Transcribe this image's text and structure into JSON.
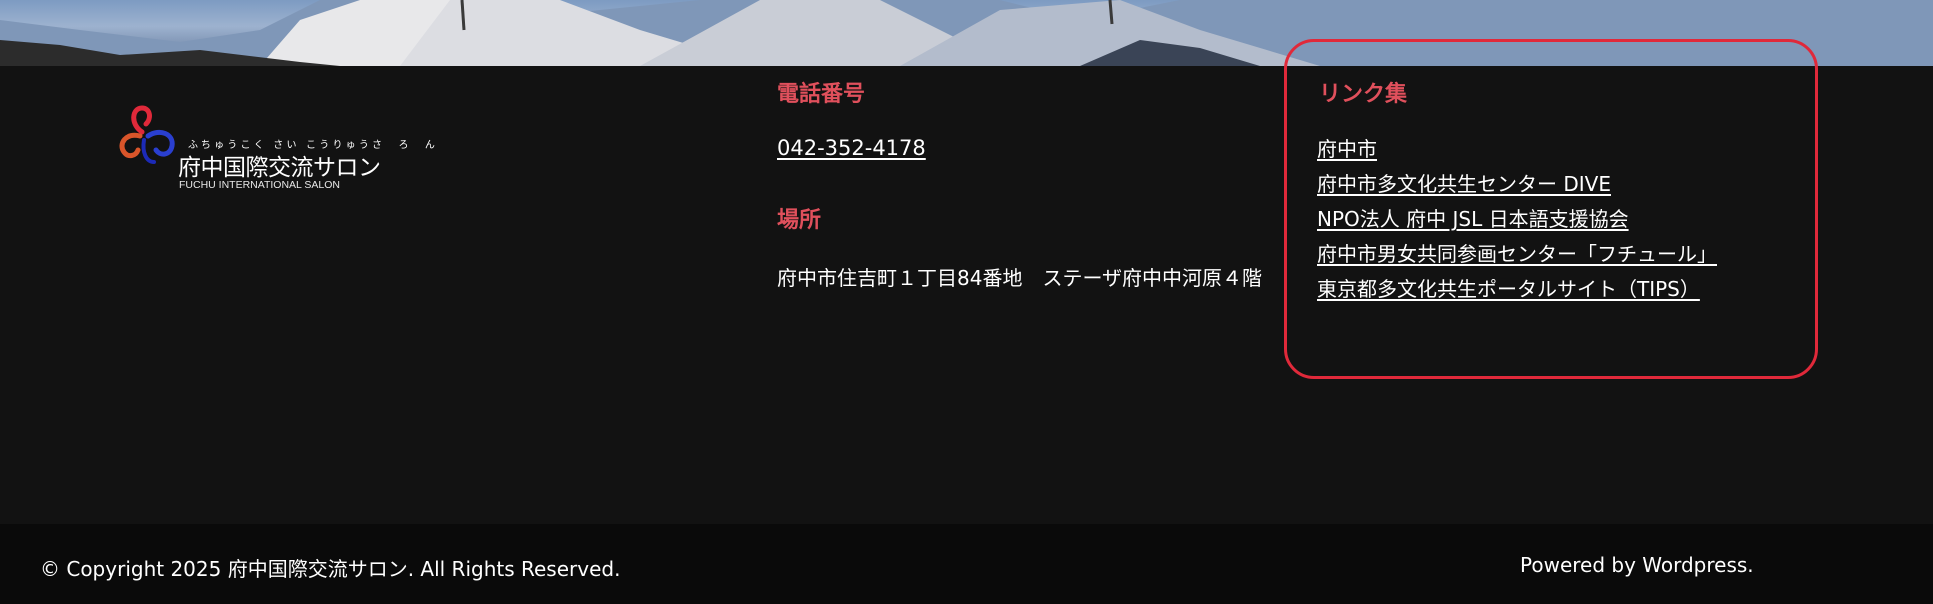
{
  "hero": {
    "image": "mountain-photo"
  },
  "logo": {
    "furigana": "ふちゅうこく さい こうりゅうさ　ろ　ん",
    "name": "府中国際交流サロン",
    "english": "FUCHU INTERNATIONAL SALON",
    "colors": [
      "#e0293a",
      "#d9552a",
      "#2a3fd0"
    ]
  },
  "contact": {
    "phone_heading": "電話番号",
    "phone": "042-352-4178",
    "location_heading": "場所",
    "address": "府中市住吉町１丁目84番地　ステーザ府中中河原４階"
  },
  "links": {
    "heading": "リンク集",
    "items": [
      {
        "label": "府中市"
      },
      {
        "label": "府中市多文化共生センター DIVE"
      },
      {
        "label": "NPO法人 府中 JSL 日本語支援協会"
      },
      {
        "label": "府中市男女共同参画センター「フチュール」"
      },
      {
        "label": "東京都多文化共生ポータルサイト（TIPS）"
      }
    ]
  },
  "footer": {
    "copyright": "© Copyright 2025 府中国際交流サロン. All Rights Reserved.",
    "powered": "Powered by Wordpress."
  },
  "colors": {
    "heading_accent": "#e0505c",
    "highlight_box": "#e0293a",
    "background": "#121212",
    "bottom_bar": "#0a0a0a"
  }
}
